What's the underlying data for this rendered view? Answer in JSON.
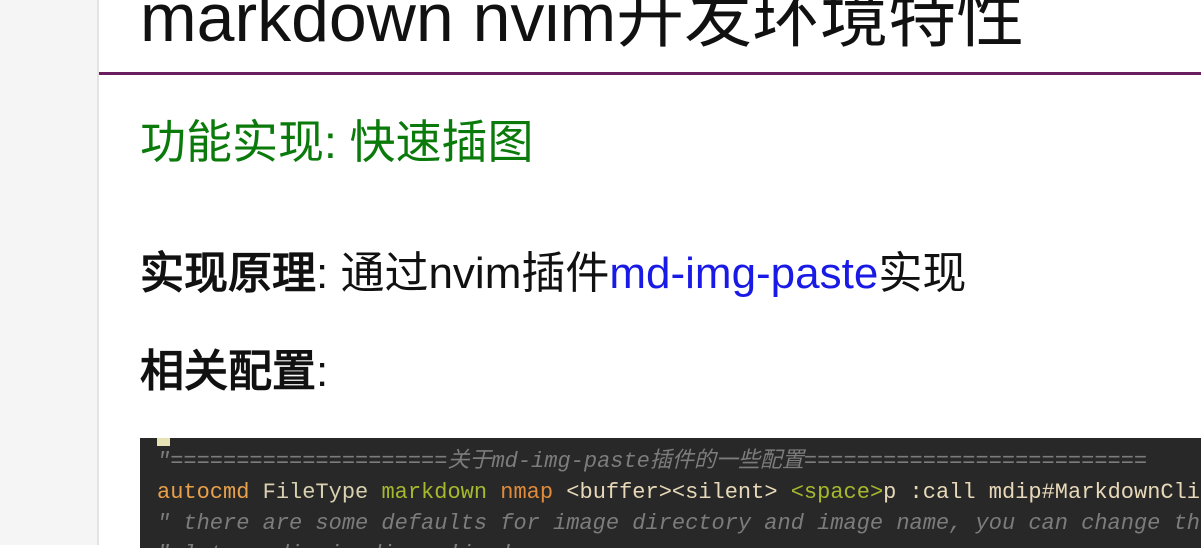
{
  "document": {
    "title": "markdown nvim开发环境特性",
    "section_heading": "功能实现: 快速插图",
    "principle": {
      "label": "实现原理",
      "colon": ":",
      "text_before": " 通过nvim插件",
      "link_text": "md-img-paste",
      "text_after": "实现"
    },
    "config": {
      "label": "相关配置",
      "colon": ":"
    }
  },
  "code": {
    "line1": "\"=====================关于md-img-paste插件的一些配置==========================",
    "line2_autocmd": "autocmd",
    "line2_filetype": " FileType",
    "line2_markdown": " markdown",
    "line2_nmap": " nmap",
    "line2_rest_a": " <buffer><silent> ",
    "line2_space": "<space>",
    "line2_rest_b": "p :call mdip#MarkdownClipboardImage()<CR>",
    "line3": "\" there are some defaults for image directory and image name, you can change them",
    "line4": "\" let g:mdip_imgdir = 'img'"
  },
  "colors": {
    "title_rule": "#6b1e5f",
    "section_heading": "#0a7a0a",
    "link": "#1a1ae6",
    "code_bg": "#282828"
  }
}
